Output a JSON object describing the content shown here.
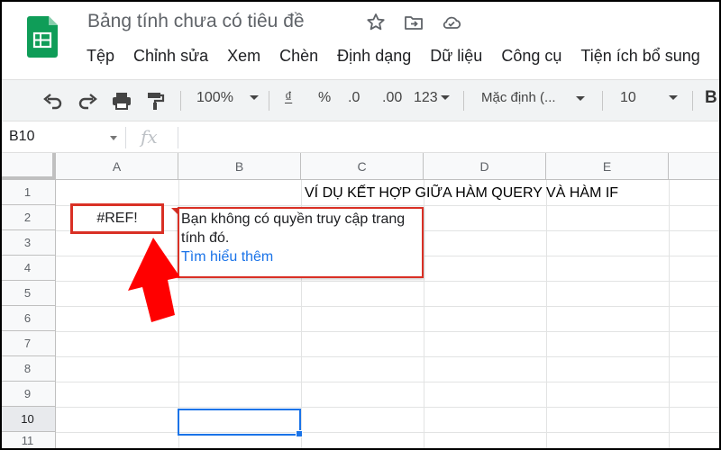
{
  "header": {
    "title": "Bảng tính chưa có tiêu đề",
    "icons": [
      "star-icon",
      "move-to-folder-icon",
      "cloud-status-icon"
    ]
  },
  "menu": [
    "Tệp",
    "Chỉnh sửa",
    "Xem",
    "Chèn",
    "Định dạng",
    "Dữ liệu",
    "Công cụ",
    "Tiện ích bổ sung"
  ],
  "toolbar": {
    "zoom": "100%",
    "currency": "₫",
    "percent": "%",
    "decrease_decimal": ".0",
    "increase_decimal": ".00",
    "more_formats": "123",
    "font": "Mặc định (...",
    "font_size": "10",
    "bold": "B"
  },
  "formula_bar": {
    "name_box": "B10",
    "fx": "fx"
  },
  "grid": {
    "columns": [
      "A",
      "B",
      "C",
      "D",
      "E"
    ],
    "rows": [
      "1",
      "2",
      "3",
      "4",
      "5",
      "6",
      "7",
      "8",
      "9",
      "10",
      "11"
    ],
    "selected_row": "10",
    "c1_text": "VÍ DỤ KẾT HỢP GIỮA HÀM QUERY VÀ HÀM IF",
    "a2_value": "#REF!"
  },
  "tooltip": {
    "line1": "Bạn không có quyền truy cập trang",
    "line2": "tính đó.",
    "link": "Tìm hiểu thêm"
  },
  "colors": {
    "error_red": "#d93025",
    "link_blue": "#1a73e8",
    "sheets_green": "#0f9d58",
    "arrow_red": "#ff0000"
  }
}
